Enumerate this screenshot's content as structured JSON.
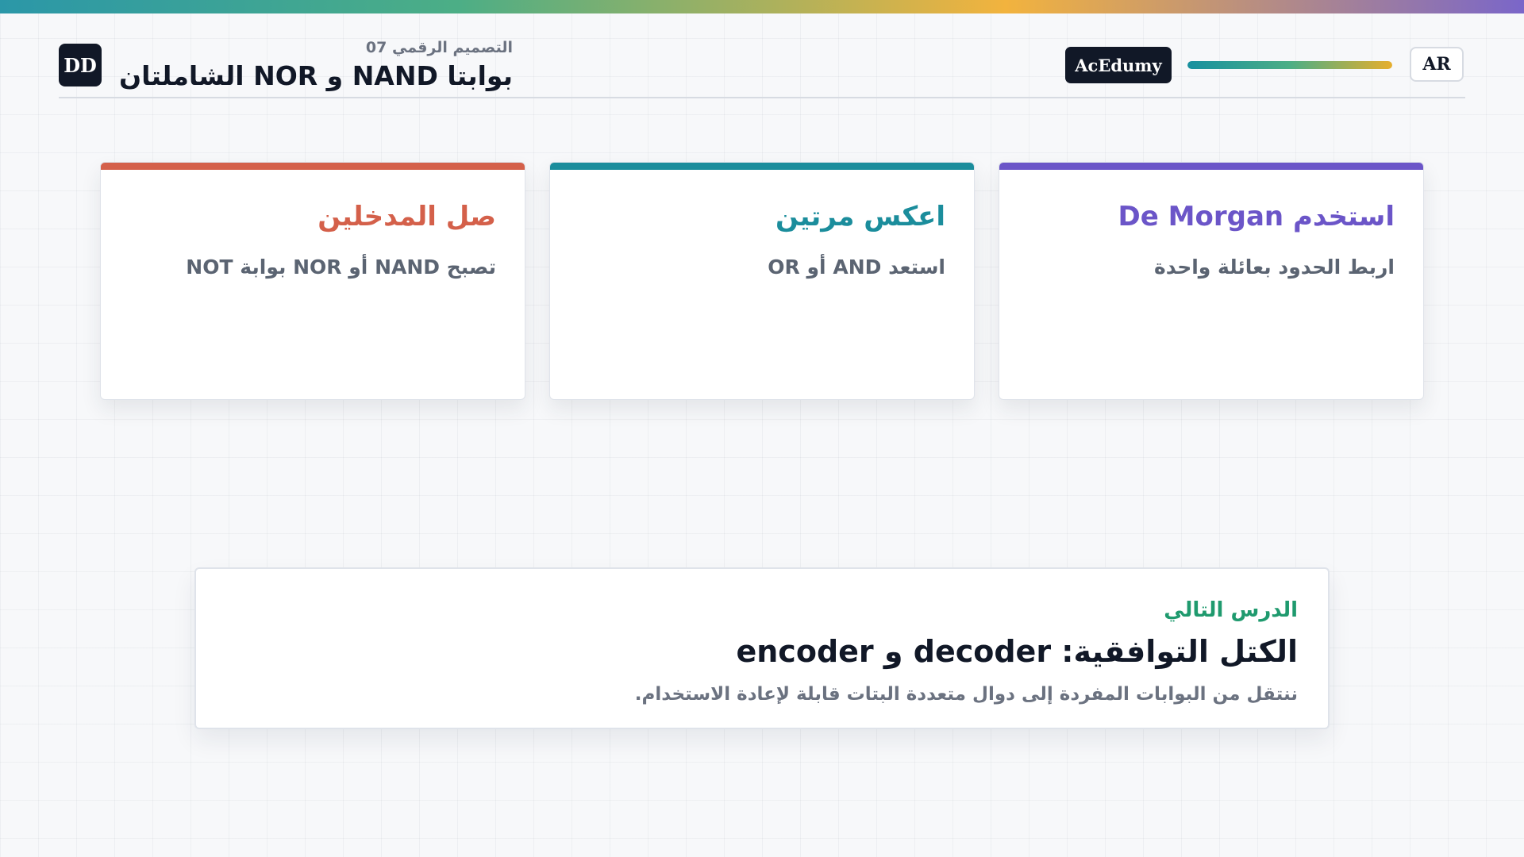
{
  "header": {
    "logo_text": "DD",
    "course_label": "التصميم الرقمي 07",
    "lesson_title": "بوابتا NAND و NOR الشاملتان",
    "brand": "AcEdumy",
    "language_button": "AR",
    "progress_fraction": 1.0
  },
  "colors": {
    "card1_accent": "#d4604a",
    "card2_accent": "#1b8d9c",
    "card3_accent": "#6b55c8",
    "next_label": "#1f9a6e"
  },
  "cards": [
    {
      "title": "صل المدخلين",
      "text": "تصبح NAND أو NOR بوابة NOT"
    },
    {
      "title": "اعكس مرتين",
      "text": "استعد AND أو OR"
    },
    {
      "title": "استخدم De Morgan",
      "text": "اربط الحدود بعائلة واحدة"
    }
  ],
  "next_lesson": {
    "label": "الدرس التالي",
    "title": "الكتل التوافقية: decoder و encoder",
    "description": "ننتقل من البوابات المفردة إلى دوال متعددة البتات قابلة لإعادة الاستخدام."
  }
}
